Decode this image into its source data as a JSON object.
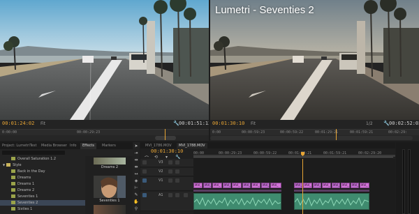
{
  "source_monitor": {
    "timecode_left": "00:01:24:02",
    "fit_label": "Fit",
    "timecode_right": "00:01:51:12",
    "ruler": [
      "0:00:00",
      "00:00:29:23"
    ]
  },
  "program_monitor": {
    "title": "Lumetri - Seventies 2",
    "timecode_left": "00:01:30:10",
    "fit_label": "Fit",
    "resolution": "1/2",
    "timecode_right": "00:02:52:02",
    "ruler": [
      "0:00",
      "00:00:59:23",
      "00:00:59:22",
      "00:01:29:21",
      "00:01:59:21",
      "00:02:29:"
    ]
  },
  "effects_panel": {
    "tabs": [
      "Project: LumetriTest",
      "Media Browser",
      "Info",
      "Effects",
      "Markers"
    ],
    "active_tab": "Effects",
    "tree": [
      {
        "label": "Overall Saturation 1.2",
        "indent": 2,
        "type": "preset"
      },
      {
        "label": "Style",
        "indent": 0,
        "type": "folder"
      },
      {
        "label": "Back in the Day",
        "indent": 2,
        "type": "preset"
      },
      {
        "label": "Dreams",
        "indent": 2,
        "type": "preset"
      },
      {
        "label": "Dreams 1",
        "indent": 2,
        "type": "preset"
      },
      {
        "label": "Dreams 2",
        "indent": 2,
        "type": "preset"
      },
      {
        "label": "Seventies 1",
        "indent": 2,
        "type": "preset"
      },
      {
        "label": "Seventies 2",
        "indent": 2,
        "type": "preset",
        "selected": true
      },
      {
        "label": "Sixties 1",
        "indent": 2,
        "type": "preset"
      }
    ],
    "thumbnails": [
      {
        "label": "Dreams 2"
      },
      {
        "label": "Seventies 1"
      },
      {
        "label": ""
      }
    ]
  },
  "timeline": {
    "tabs": [
      "MVI_1786.MOV",
      "MVI_1788.MOV"
    ],
    "active_tab": "MVI_1788.MOV",
    "timecode": "00:01:30:10",
    "ruler": [
      "00:00",
      "00:00:29:23",
      "00:00:59:22",
      "00:01:29:21",
      "00:01:59:21",
      "00:02:29:20"
    ],
    "track_labels": [
      "V3",
      "V2",
      "V1",
      "A1"
    ],
    "video_clip_labels": [
      "MVI_",
      "MVI_",
      "MVI_",
      "MVI_",
      "MVI_",
      "MVI_",
      "MVI_",
      "MVI_",
      "MVI_",
      "MVI_",
      "MVI_",
      "MVI_",
      "MVI_",
      "MVI_",
      "MVI_",
      "MVI_",
      "MVI_"
    ],
    "audio_label": "Aud"
  },
  "colors": {
    "accent_orange": "#e8a534",
    "video_clip": "#d274d8",
    "audio_clip": "#3f8b6f",
    "selection": "#3b4656"
  }
}
